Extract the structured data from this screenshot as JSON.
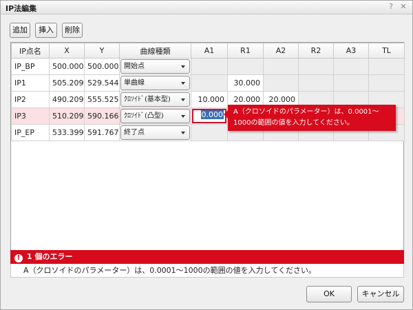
{
  "window": {
    "title": "IP法編集",
    "help_label": "?",
    "close_label": "✕"
  },
  "toolbar": {
    "add_label": "追加",
    "insert_label": "挿入",
    "delete_label": "削除"
  },
  "table": {
    "columns": [
      "IP点名",
      "X",
      "Y",
      "曲線種類",
      "A1",
      "R1",
      "A2",
      "R2",
      "A3",
      "TL"
    ],
    "rows": [
      {
        "name": "IP_BP",
        "x": "500.000",
        "y": "500.000",
        "curve": "開始点",
        "a1": "",
        "r1": "",
        "a2": "",
        "r2": "",
        "a3": "",
        "tl": ""
      },
      {
        "name": "IP1",
        "x": "505.209",
        "y": "529.544",
        "curve": "単曲線",
        "a1": "",
        "r1": "30.000",
        "a2": "",
        "r2": "",
        "a3": "",
        "tl": ""
      },
      {
        "name": "IP2",
        "x": "490.209",
        "y": "555.525",
        "curve": "ｸﾛｿｲﾄﾞ(基本型)",
        "a1": "10.000",
        "r1": "20.000",
        "a2": "20.000",
        "r2": "",
        "a3": "",
        "tl": ""
      },
      {
        "name": "IP3",
        "x": "510.209",
        "y": "590.166",
        "curve": "ｸﾛｿｲﾄﾞ(凸型)",
        "a1": "0.000",
        "r1": "",
        "a2": "",
        "r2": "",
        "a3": "",
        "tl": ""
      },
      {
        "name": "IP_EP",
        "x": "533.399",
        "y": "591.767",
        "curve": "終了点",
        "a1": "",
        "r1": "",
        "a2": "",
        "r2": "",
        "a3": "",
        "tl": ""
      }
    ]
  },
  "tooltip": {
    "message": "A（クロソイドのパラメーター）は、0.0001～1000の範囲の値を入力してください。"
  },
  "errors": {
    "icon": "error-icon",
    "summary": "1 個のエラー",
    "detail": "A（クロソイドのパラメーター）は、0.0001～1000の範囲の値を入力してください。"
  },
  "footer": {
    "ok_label": "OK",
    "cancel_label": "キャンセル"
  },
  "colors": {
    "error_red": "#d70b1c",
    "error_row_pink": "#fbe1e4"
  }
}
